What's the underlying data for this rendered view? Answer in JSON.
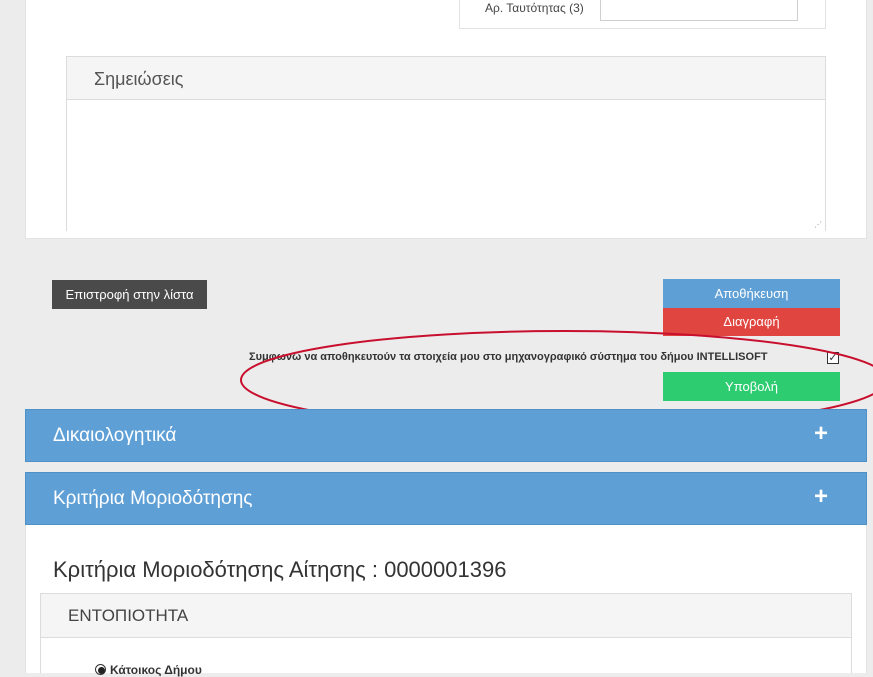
{
  "top_form": {
    "id_label": "Αρ. Ταυτότητας (3)",
    "id_value": ""
  },
  "notes": {
    "title": "Σημειώσεις",
    "value": ""
  },
  "actions": {
    "back_label": "Επιστροφή στην λίστα",
    "save_label": "Αποθήκευση",
    "delete_label": "Διαγραφή",
    "submit_label": "Υποβολή",
    "consent_text": "Συμφωνώ να αποθηκευτούν τα στοιχεία μου στο μηχανογραφικό σύστημα του δήμου INTELLISOFT",
    "consent_checked": true
  },
  "accordions": [
    {
      "title": "Δικαιολογητικά",
      "icon": "plus-icon"
    },
    {
      "title": "Κριτήρια Μοριοδότησης",
      "icon": "plus-icon"
    }
  ],
  "criteria": {
    "heading": "Κριτήρια Μοριοδότησης Αίτησης : 0000001396",
    "section_title": "ΕΝΤΟΠΙΟΤΗΤΑ",
    "option_label": "Κάτοικος Δήμου",
    "option_selected": true
  },
  "colors": {
    "blue": "#5e9fd6",
    "red": "#e0453f",
    "green": "#2ecc71",
    "dark": "#4a4a4a",
    "annotation": "#c8102e"
  }
}
